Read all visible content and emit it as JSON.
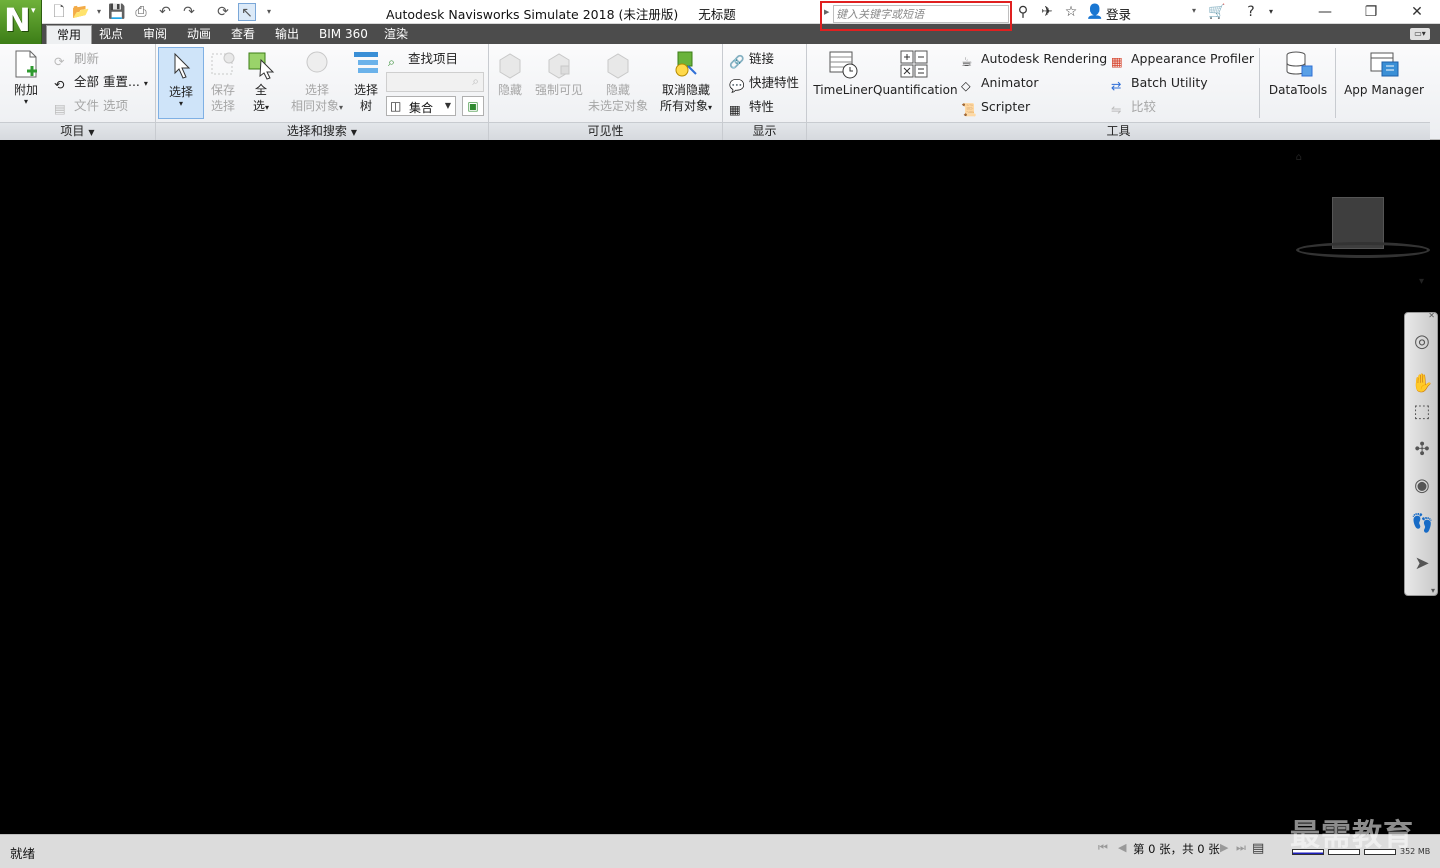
{
  "title_bar": {
    "app_name": "Autodesk Navisworks Simulate 2018 (未注册版)",
    "document": "无标题",
    "search_placeholder": "键入关键字或短语",
    "login": "登录"
  },
  "tabs": [
    {
      "label": "常用",
      "active": true
    },
    {
      "label": "视点",
      "active": false
    },
    {
      "label": "审阅",
      "active": false
    },
    {
      "label": "动画",
      "active": false
    },
    {
      "label": "查看",
      "active": false
    },
    {
      "label": "输出",
      "active": false
    },
    {
      "label": "BIM 360",
      "active": false
    },
    {
      "label": "渲染",
      "active": false
    }
  ],
  "panels": {
    "project": {
      "label": "项目",
      "append": "附加",
      "refresh": "刷新",
      "reset_all": "全部 重置...",
      "file_options": "文件 选项"
    },
    "select_search": {
      "label": "选择和搜索",
      "select_1": "选择",
      "save_select_1": "保存",
      "save_select_2": "选择",
      "select_all_1": "全",
      "select_all_2": "选",
      "select_same_1": "选择",
      "select_same_2": "相同对象",
      "select_tree_1": "选择",
      "select_tree_2": "树",
      "find_items": "查找项目",
      "sets": "集合"
    },
    "visibility": {
      "label": "可见性",
      "hide": "隐藏",
      "require": "强制可见",
      "hide_unselected_1": "隐藏",
      "hide_unselected_2": "未选定对象",
      "unhide_all_1": "取消隐藏",
      "unhide_all_2": "所有对象"
    },
    "display": {
      "label": "显示",
      "links": "链接",
      "quick_props": "快捷特性",
      "properties": "特性"
    },
    "tools": {
      "label": "工具",
      "timeliner": "TimeLiner",
      "quantification": "Quantification",
      "autodesk_rendering": "Autodesk Rendering",
      "animator": "Animator",
      "scripter": "Scripter",
      "appearance_profiler": "Appearance Profiler",
      "batch_utility": "Batch Utility",
      "compare": "比较",
      "datatools": "DataTools",
      "app_manager": "App Manager"
    }
  },
  "status_bar": {
    "status": "就绪",
    "page_info": "第 0 张，共 0 张",
    "memory": "352 MB"
  },
  "watermark": "最需教育",
  "colors": {
    "highlight_border": "#e02020",
    "logo_green": "#4f9a22",
    "tab_bar": "#4c4c4c",
    "viewport": "#000000"
  }
}
